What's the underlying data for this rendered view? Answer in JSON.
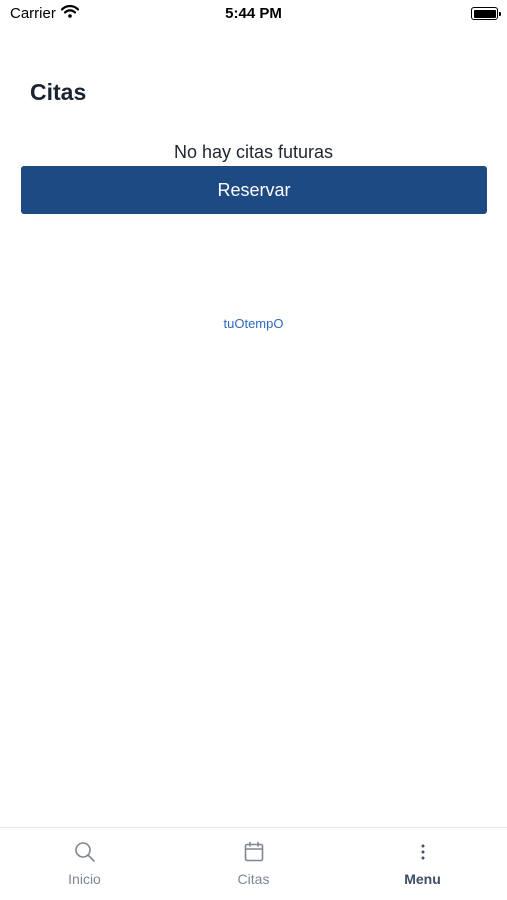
{
  "status_bar": {
    "carrier": "Carrier",
    "time": "5:44 PM"
  },
  "page": {
    "title": "Citas",
    "empty_message": "No hay citas futuras",
    "reserve_label": "Reservar",
    "brand_link": "tuOtempO"
  },
  "tabs": [
    {
      "label": "Inicio",
      "icon": "search-icon"
    },
    {
      "label": "Citas",
      "icon": "calendar-icon"
    },
    {
      "label": "Menu",
      "icon": "more-vertical-icon",
      "active": true
    }
  ],
  "colors": {
    "primary": "#1d4a82",
    "link": "#2e6bbf",
    "tab_inactive": "#7d8692",
    "tab_active": "#3d4f66"
  }
}
